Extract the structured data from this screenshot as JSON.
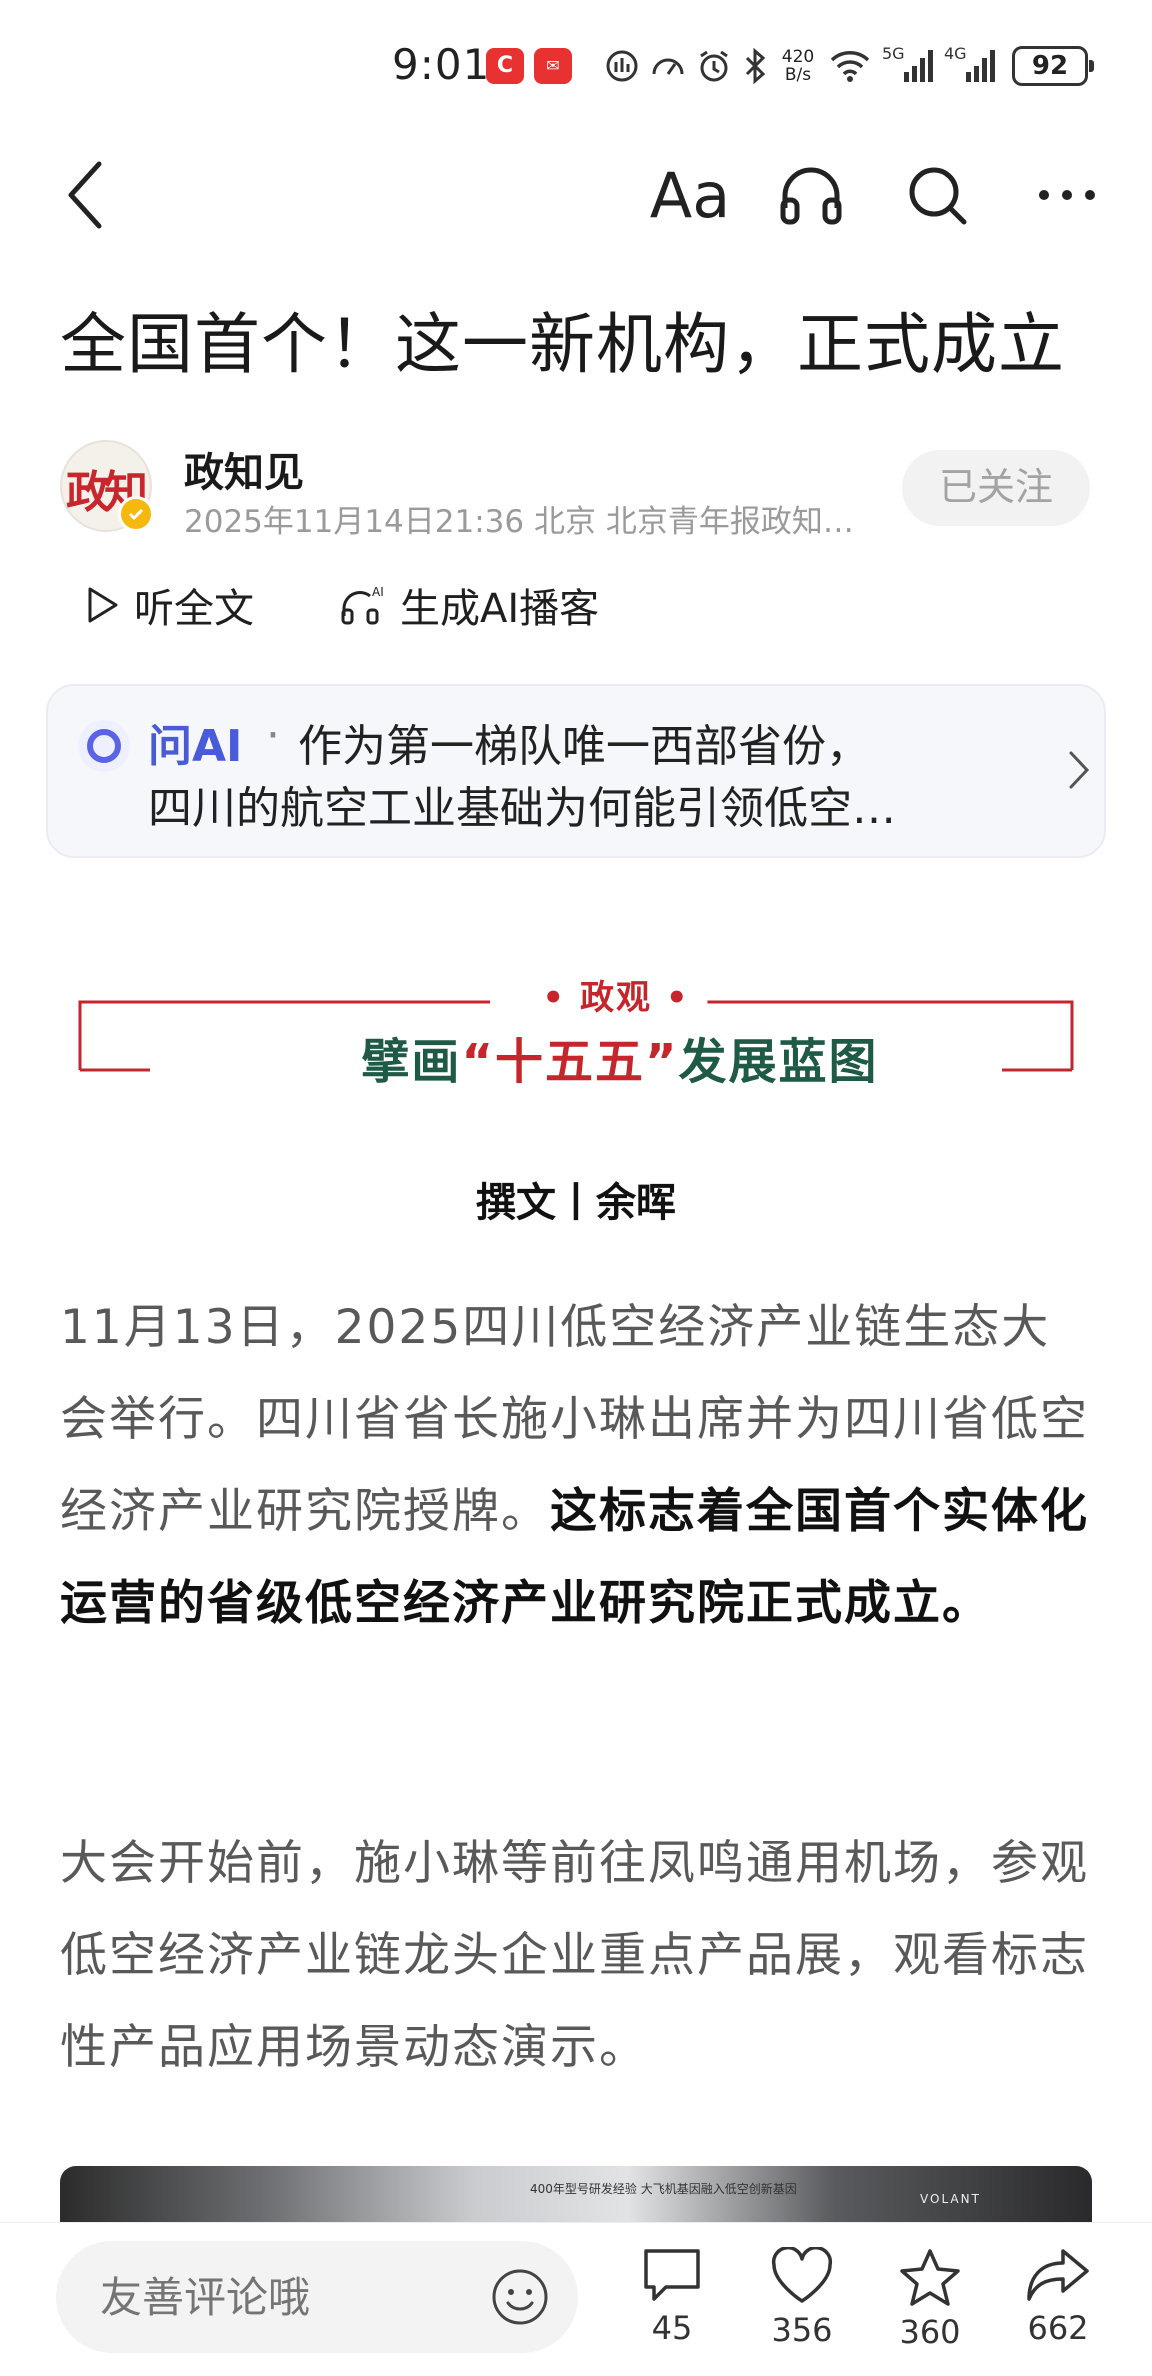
{
  "status_bar": {
    "time": "9:01",
    "net_speed_top": "420",
    "net_speed_bottom": "B/s",
    "sim1": "5G",
    "sim2": "4G",
    "battery": "92"
  },
  "nav": {
    "font_size_label": "Aa"
  },
  "article": {
    "title": "全国首个！这一新机构，正式成立",
    "author": {
      "name": "政知见",
      "avatar_text": "政知",
      "meta": "2025年11月14日21:36 北京 北京青年报政知…",
      "follow_label": "已关注"
    },
    "audio": {
      "listen_label": "听全文",
      "podcast_label": "生成AI播客"
    },
    "ai_box": {
      "label": "问AI",
      "dot": "·",
      "line1": "作为第一梯队唯一西部省份，",
      "line2": "四川的航空工业基础为何能引领低空…"
    },
    "banner": {
      "tag": "• 政观 •",
      "title_prefix": "擘画",
      "title_highlight": "“十五五”",
      "title_suffix": "发展蓝图"
    },
    "byline": "撰文丨余晖",
    "para1_normal": "11月13日，2025四川低空经济产业链生态大会举行。四川省省长施小琳出席并为四川省低空经济产业研究院授牌。",
    "para1_bold": "这标志着全国首个实体化运营的省级低空经济产业研究院正式成立。",
    "para2": "大会开始前，施小琳等前往凤鸣通用机场，参观低空经济产业链龙头企业重点产品展，观看标志性产品应用场景动态演示。",
    "image_caption_a": "400年型号研发经验 大飞机基因融入低空创新基因",
    "image_caption_b": "VOLANT"
  },
  "bottom_bar": {
    "comment_placeholder": "友善评论哦",
    "comments": "45",
    "likes": "356",
    "favorites": "360",
    "shares": "662"
  }
}
